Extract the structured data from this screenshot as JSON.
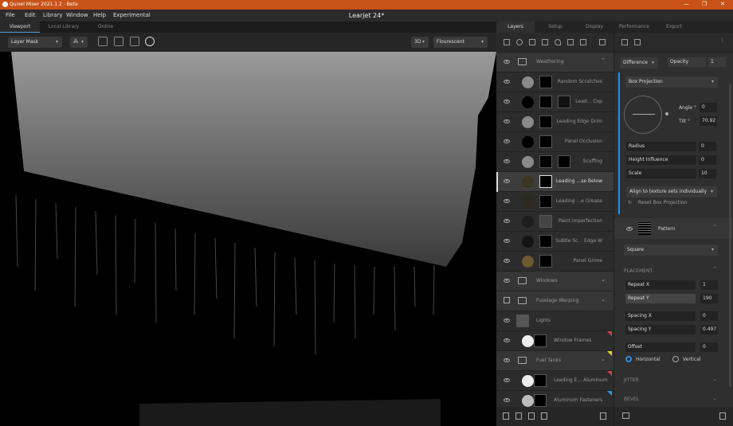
{
  "app": {
    "title": "Quixel Mixer 2021.1.2 - Beta",
    "document_title": "Learjet 24*"
  },
  "menu": [
    "File",
    "Edit",
    "Library",
    "Window",
    "Help",
    "Experimental"
  ],
  "viewport_tabs": [
    "Viewport",
    "Local Library",
    "Online"
  ],
  "viewport_toolbar": {
    "mode": "Layer Mask",
    "view": "3D",
    "lighting": "Flourescent"
  },
  "right_tabs": [
    "Layers",
    "Setup",
    "Display",
    "Performance",
    "Export"
  ],
  "layers": [
    {
      "name": "Weathering",
      "type": "folder"
    },
    {
      "name": "Random Scratches",
      "type": "layer",
      "color": "#8a8a8a"
    },
    {
      "name": "Lead... Cop",
      "type": "layer",
      "color": "#000000"
    },
    {
      "name": "Leading Edge Grim",
      "type": "layer",
      "color": "#8a8a8a"
    },
    {
      "name": "Panel Occlusion",
      "type": "layer",
      "color": "#000000"
    },
    {
      "name": "Scuffing",
      "type": "layer",
      "color": "#8a8a8a"
    },
    {
      "name": "Leading ...se Below",
      "type": "layer",
      "color": "#3d3424",
      "selected": true
    },
    {
      "name": "Leading ...e Grease",
      "type": "layer",
      "color": "#2e2a20"
    },
    {
      "name": "Paint Imperfection",
      "type": "layer",
      "color": "#1e1e1e"
    },
    {
      "name": "Subtle Sc... Edge W",
      "type": "layer",
      "color": "#141414"
    },
    {
      "name": "Panel Grime",
      "type": "layer",
      "color": "#6e5a30"
    },
    {
      "name": "Windows",
      "type": "folder"
    },
    {
      "name": "Fuselage Warping",
      "type": "folder"
    },
    {
      "name": "Lights",
      "type": "lights"
    },
    {
      "name": "Window Frames",
      "type": "layer",
      "color": "#eeeeee",
      "tag": "#e0394a"
    },
    {
      "name": "Fuel Tanks",
      "type": "folder",
      "tag": "#e8d42a"
    },
    {
      "name": "Leading E... Aluminum",
      "type": "layer",
      "color": "#eeeeee",
      "tag": "#e0394a"
    },
    {
      "name": "Aluminum Fasteners",
      "type": "layer",
      "color": "#bbbbbb",
      "tag": "#2a9be0"
    }
  ],
  "props": {
    "blend_mode": "Difference",
    "opacity_label": "Opacity",
    "opacity": "1",
    "projection": "Box Projection",
    "angle_label": "Angle °",
    "angle": "0",
    "tilt_label": "Tilt °",
    "tilt": "70.92",
    "radius_label": "Radius",
    "radius": "0",
    "height_influence_label": "Height Influence",
    "height_influence": "0",
    "scale_label": "Scale",
    "scale": "10",
    "align": "Align to texture sets individually",
    "reset": "Reset Box Projection",
    "pattern_label": "Pattern",
    "pattern_shape": "Square",
    "placement_label": "PLACEMENT",
    "repeat_x_label": "Repeat X",
    "repeat_x": "1",
    "repeat_y_label": "Repeat Y",
    "repeat_y": "190",
    "spacing_x_label": "Spacing X",
    "spacing_x": "0",
    "spacing_y_label": "Spacing Y",
    "spacing_y": "0.497",
    "offset_label": "Offset",
    "offset": "0",
    "horizontal_label": "Horizontal",
    "vertical_label": "Vertical",
    "jitter_label": "JITTER",
    "bevel_label": "BEVEL"
  }
}
